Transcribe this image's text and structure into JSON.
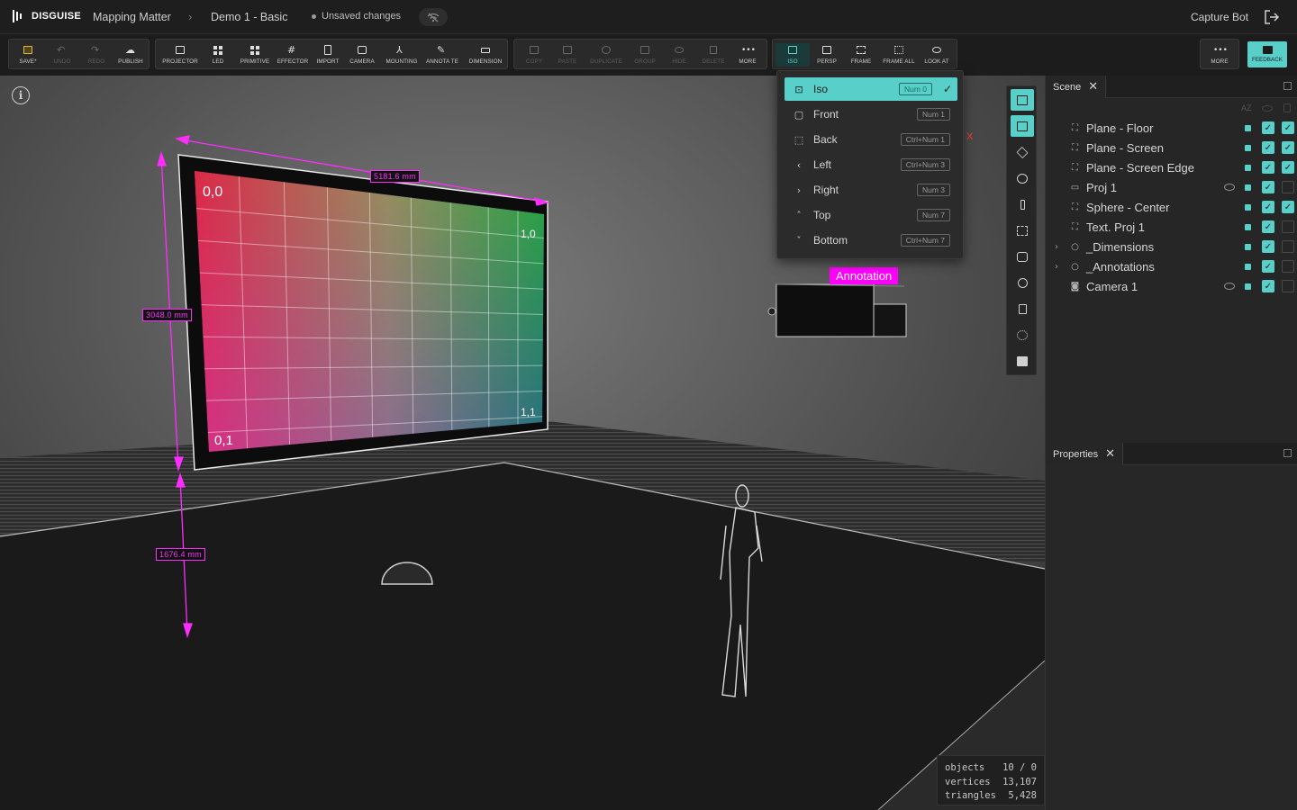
{
  "header": {
    "brand": "DISGUISE",
    "project": "Mapping Matter",
    "file": "Demo 1 - Basic",
    "status": "Unsaved changes",
    "user": "Capture Bot"
  },
  "toolbar": {
    "file_group": [
      {
        "id": "save",
        "label": "SAVE*",
        "icon": "save-icon",
        "enabled": true
      },
      {
        "id": "undo",
        "label": "UNDO",
        "icon": "undo-icon",
        "enabled": false
      },
      {
        "id": "redo",
        "label": "REDO",
        "icon": "redo-icon",
        "enabled": false
      },
      {
        "id": "publish",
        "label": "PUBLISH",
        "icon": "cloud-upload-icon",
        "enabled": true
      }
    ],
    "create_group": [
      {
        "id": "projector",
        "label": "PROJECTOR",
        "icon": "projector-icon"
      },
      {
        "id": "led",
        "label": "LED",
        "icon": "led-grid-icon"
      },
      {
        "id": "primitive",
        "label": "PRIMITIVE",
        "icon": "cube-icon"
      },
      {
        "id": "effector",
        "label": "EFFECTOR",
        "icon": "hash-grid-icon"
      },
      {
        "id": "import",
        "label": "IMPORT",
        "icon": "file-import-icon"
      },
      {
        "id": "camera",
        "label": "CAMERA",
        "icon": "camera-icon"
      },
      {
        "id": "mounting",
        "label": "MOUNTING",
        "icon": "tripod-icon"
      },
      {
        "id": "annotate",
        "label": "ANNOTA TE",
        "icon": "pencil-icon"
      },
      {
        "id": "dimension",
        "label": "DIMENSION",
        "icon": "ruler-icon"
      }
    ],
    "edit_group": [
      {
        "id": "copy",
        "label": "COPY",
        "icon": "copy-icon"
      },
      {
        "id": "paste",
        "label": "PASTE",
        "icon": "clipboard-icon"
      },
      {
        "id": "duplicate",
        "label": "DUPLICATE",
        "icon": "duplicate-icon"
      },
      {
        "id": "group",
        "label": "GROUP",
        "icon": "folder-icon"
      },
      {
        "id": "hide",
        "label": "HIDE",
        "icon": "eye-off-icon"
      },
      {
        "id": "delete",
        "label": "DELETE",
        "icon": "trash-icon"
      },
      {
        "id": "more",
        "label": "MORE",
        "icon": "more-dots-icon"
      }
    ],
    "view_group": [
      {
        "id": "iso",
        "label": "ISO",
        "icon": "iso-view-icon"
      },
      {
        "id": "persp",
        "label": "PERSP",
        "icon": "perspective-icon"
      },
      {
        "id": "frame",
        "label": "FRAME",
        "icon": "frame-icon"
      },
      {
        "id": "frame_all",
        "label": "FRAME ALL",
        "icon": "frame-all-icon"
      },
      {
        "id": "look_at",
        "label": "LOOK AT",
        "icon": "eye-icon"
      }
    ],
    "more_label": "MORE",
    "feedback_label": "FEEDBACK"
  },
  "view_menu": {
    "items": [
      {
        "label": "Iso",
        "shortcut": "Num 0",
        "selected": true,
        "icon": "iso-view-icon"
      },
      {
        "label": "Front",
        "shortcut": "Num 1",
        "icon": "front-view-icon"
      },
      {
        "label": "Back",
        "shortcut": "Ctrl+Num 1",
        "icon": "back-view-icon"
      },
      {
        "label": "Left",
        "shortcut": "Ctrl+Num 3",
        "icon": "chevron-left-icon"
      },
      {
        "label": "Right",
        "shortcut": "Num 3",
        "icon": "chevron-right-icon"
      },
      {
        "label": "Top",
        "shortcut": "Num 7",
        "icon": "chevron-up-icon"
      },
      {
        "label": "Bottom",
        "shortcut": "Ctrl+Num 7",
        "icon": "chevron-down-icon"
      }
    ]
  },
  "viewport": {
    "dimensions": {
      "width": "5181.6 mm",
      "height": "3048.0 mm",
      "elevation": "1676.4 mm"
    },
    "annotation": "Annotation",
    "axis_label": "X",
    "led_labels": {
      "top_left": "0,0",
      "top_right": "1,0",
      "bottom_left": "0,1",
      "bottom_right": "1,1"
    },
    "stats": [
      {
        "label": "objects",
        "value": "10 / 0"
      },
      {
        "label": "vertices",
        "value": "13,107"
      },
      {
        "label": "triangles",
        "value": "5,428"
      }
    ]
  },
  "side_tools": [
    "scene-tree-icon",
    "properties-sliders-icon",
    "layers-icon",
    "gizmo-icon",
    "thermometer-icon",
    "grid-icon",
    "snapshot-icon",
    "settings-icon",
    "document-icon",
    "history-icon",
    "image-icon"
  ],
  "scene_panel": {
    "title": "Scene",
    "items": [
      {
        "label": "Plane - Floor",
        "icon": "mesh-icon",
        "expandable": false,
        "eye": false,
        "check1": true,
        "check2": true
      },
      {
        "label": "Plane - Screen",
        "icon": "mesh-icon",
        "expandable": false,
        "eye": false,
        "check1": true,
        "check2": true
      },
      {
        "label": "Plane - Screen Edge",
        "icon": "mesh-icon",
        "expandable": false,
        "eye": false,
        "check1": true,
        "check2": true
      },
      {
        "label": "Proj 1",
        "icon": "projector-icon",
        "expandable": false,
        "eye": true,
        "check1": true,
        "check2": false
      },
      {
        "label": "Sphere - Center",
        "icon": "mesh-icon",
        "expandable": false,
        "eye": false,
        "check1": true,
        "check2": true
      },
      {
        "label": "Text. Proj 1",
        "icon": "mesh-icon",
        "expandable": false,
        "eye": false,
        "check1": true,
        "check2": false
      },
      {
        "label": "_Dimensions",
        "icon": "group-circle-icon",
        "expandable": true,
        "eye": false,
        "check1": true,
        "check2": false
      },
      {
        "label": "_Annotations",
        "icon": "group-circle-icon",
        "expandable": true,
        "eye": false,
        "check1": true,
        "check2": false
      },
      {
        "label": "Camera 1",
        "icon": "camera-icon",
        "expandable": false,
        "eye": true,
        "check1": true,
        "check2": false
      }
    ]
  },
  "properties_panel": {
    "title": "Properties"
  },
  "colors": {
    "accent": "#58cfc8",
    "dimension": "#ff2dff",
    "annotation": "#ff00ff"
  }
}
